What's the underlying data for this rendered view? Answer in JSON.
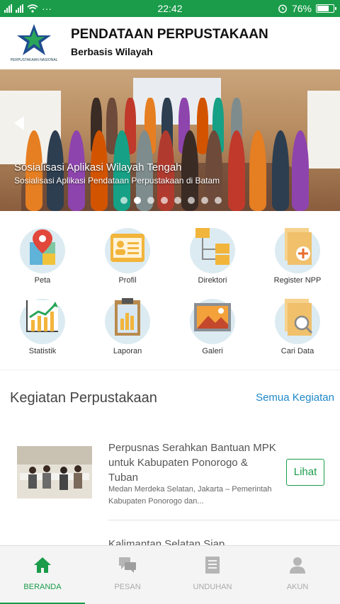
{
  "status_bar": {
    "time": "22:42",
    "battery": "76%",
    "dots": "···",
    "battery_level": 0.76
  },
  "header": {
    "title": "PENDATAAN PERPUSTAKAAN",
    "subtitle": "Berbasis Wilayah",
    "logo_text": "PERPUSTAKAAN NASIONAL"
  },
  "banner": {
    "title": "Sosialisasi Aplikasi Wilayah Tengah",
    "caption": "Sosialisasi Aplikasi Pendataan Perpustakaan di Batam",
    "slide_count": 8,
    "active_slide": 1
  },
  "menu": [
    {
      "label": "Peta",
      "icon": "map-pin-icon"
    },
    {
      "label": "Profil",
      "icon": "id-card-icon"
    },
    {
      "label": "Direktori",
      "icon": "folder-tree-icon"
    },
    {
      "label": "Register NPP",
      "icon": "document-plus-icon"
    },
    {
      "label": "Statistik",
      "icon": "line-chart-icon"
    },
    {
      "label": "Laporan",
      "icon": "clipboard-chart-icon"
    },
    {
      "label": "Galeri",
      "icon": "picture-icon"
    },
    {
      "label": "Cari Data",
      "icon": "document-search-icon"
    }
  ],
  "kegiatan": {
    "title": "Kegiatan Perpustakaan",
    "link": "Semua Kegiatan",
    "items": [
      {
        "title": "Perpusnas Serahkan Bantuan MPK untuk Kabupaten Ponorogo & Tuban",
        "meta": "Medan Merdeka Selatan, Jakarta – Pemerintah Kabupaten Ponorogo dan...",
        "button": "Lihat"
      },
      {
        "title": "Kalimantan Selatan Siap..."
      }
    ]
  },
  "bottom_nav": [
    {
      "label": "BERANDA",
      "icon": "home-icon",
      "active": true
    },
    {
      "label": "PESAN",
      "icon": "chat-icon",
      "active": false
    },
    {
      "label": "UNDUHAN",
      "icon": "download-list-icon",
      "active": false
    },
    {
      "label": "AKUN",
      "icon": "user-icon",
      "active": false
    }
  ],
  "colors": {
    "brand": "#1a9c4a",
    "link": "#1e88c8"
  }
}
